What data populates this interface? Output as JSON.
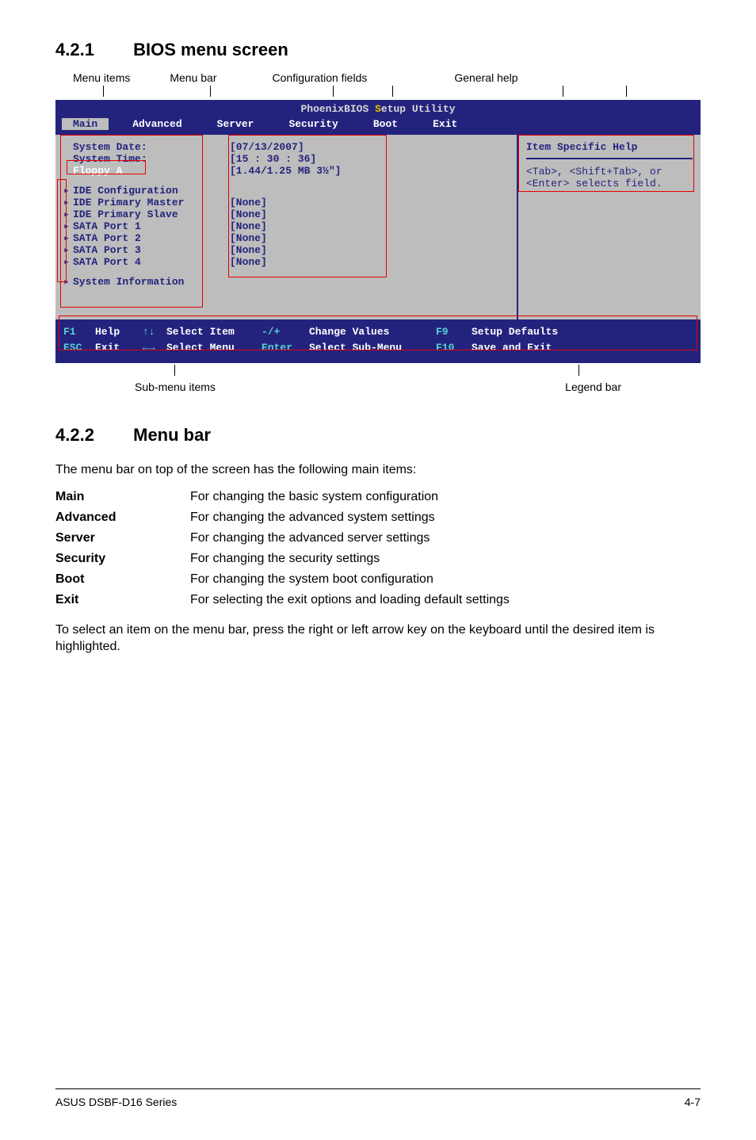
{
  "section1": {
    "num": "4.2.1",
    "title": "BIOS menu screen"
  },
  "topLabels": {
    "menuItems": "Menu items",
    "menuBar": "Menu bar",
    "configFields": "Configuration fields",
    "generalHelp": "General help"
  },
  "bios": {
    "utilityTitlePrefix": "PhoenixBIOS ",
    "utilityTitleS": "S",
    "utilityTitleSuffix": "etup Utility",
    "tabs": {
      "main": "Main",
      "advanced": "Advanced",
      "server": "Server",
      "security": "Security",
      "boot": "Boot",
      "exit": "Exit"
    },
    "left": {
      "systemDateLabel": "System Date:",
      "systemDateValue": "[07/13/2007]",
      "systemTimeLabel": "System Time:",
      "systemTimeValue": "[15 : 30 : 36]",
      "floppyLabel": "Floppy A",
      "floppyValue": "[1.44/1.25 MB 3½\"]",
      "ideConfig": "IDE Configuration",
      "idePrimaryMaster": "IDE Primary Master",
      "idePrimarySlave": "IDE Primary Slave",
      "sata1": "SATA Port 1",
      "sata2": "SATA Port 2",
      "sata3": "SATA Port 3",
      "sata4": "SATA Port 4",
      "none": "[None]",
      "systemInfo": "System Information"
    },
    "right": {
      "header": "Item Specific Help",
      "help": "<Tab>, <Shift+Tab>, or <Enter> selects field."
    },
    "legend": {
      "f1": "F1",
      "help": "Help",
      "esc": "ESC",
      "exit": "Exit",
      "selectItem": "Select Item",
      "selectMenu": "Select Menu",
      "minusPlus": "-/+",
      "changeValues": "Change Values",
      "enter": "Enter",
      "selectSub": "Select   Sub-Menu",
      "f9": "F9",
      "setupDefaults": "Setup Defaults",
      "f10": "F10",
      "saveExit": "Save and Exit"
    }
  },
  "bottomLabels": {
    "subMenu": "Sub-menu items",
    "legendBar": "Legend bar"
  },
  "section2": {
    "num": "4.2.2",
    "title": "Menu bar"
  },
  "menubarDesc": "The menu bar on top of the screen has the following main items:",
  "defs": {
    "main": {
      "term": "Main",
      "desc": "For changing the basic system configuration"
    },
    "advanced": {
      "term": "Advanced",
      "desc": "For changing the advanced system settings"
    },
    "server": {
      "term": "Server",
      "desc": "For changing the advanced server settings"
    },
    "security": {
      "term": "Security",
      "desc": "For changing the security settings"
    },
    "boot": {
      "term": "Boot",
      "desc": "For changing the system boot configuration"
    },
    "exit": {
      "term": "Exit",
      "desc": "For selecting the exit options and loading default settings"
    }
  },
  "afterTable": "To select an item on the menu bar, press the right or left arrow key on the keyboard until the desired item is highlighted.",
  "footer": {
    "left": "ASUS DSBF-D16 Series",
    "right": "4-7"
  }
}
